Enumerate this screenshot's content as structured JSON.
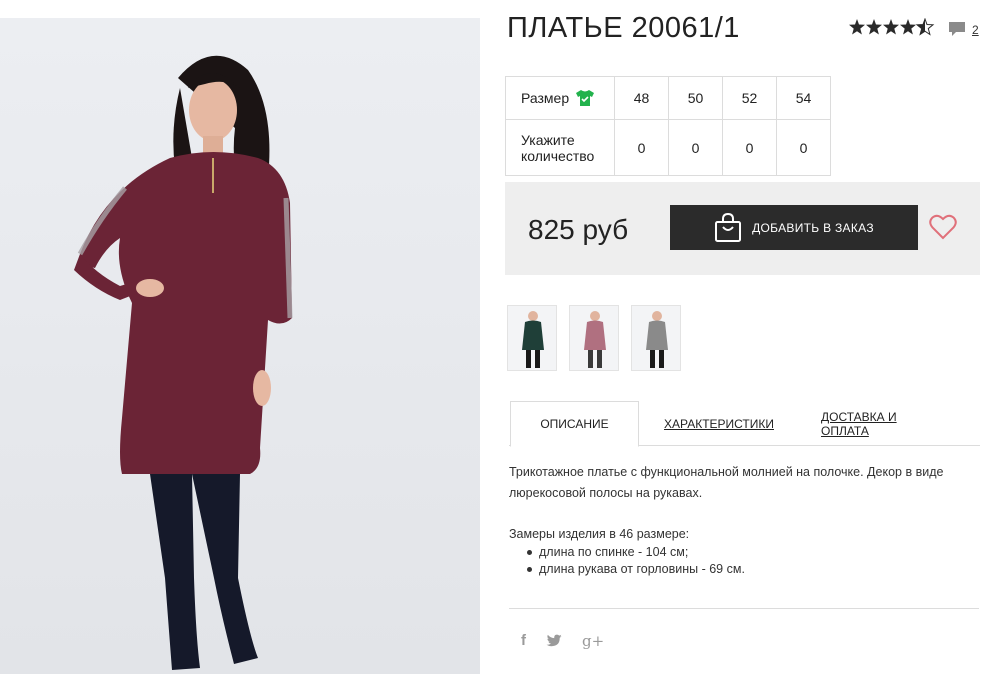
{
  "product": {
    "title": "ПЛАТЬЕ 20061/1",
    "rating_value": 4.5,
    "rating_max": 5,
    "comments_count": "2"
  },
  "sizes": {
    "size_label": "Размер",
    "qty_label_line1": "Укажите",
    "qty_label_line2": "количество",
    "columns": [
      "48",
      "50",
      "52",
      "54"
    ],
    "quantities": [
      "0",
      "0",
      "0",
      "0"
    ]
  },
  "purchase": {
    "price": "825 руб",
    "add_button": "ДОБАВИТЬ В ЗАКАЗ"
  },
  "thumbnails": [
    {
      "color": "#1f3f38"
    },
    {
      "color": "#6b2436"
    },
    {
      "color": "#8a8a8a"
    }
  ],
  "tabs": {
    "description": "ОПИСАНИЕ",
    "characteristics": "ХАРАКТЕРИСТИКИ",
    "delivery": "ДОСТАВКА И ОПЛАТА"
  },
  "description": {
    "text": "Трикотажное платье с функциональной молнией на полочке. Декор в виде люрекосовой полосы на рукавах.",
    "measures_title": "Замеры изделия в 46 размере:",
    "measures": [
      "длина по спинке - 104 см;",
      "длина рукава от горловины - 69 см."
    ]
  },
  "social": {
    "facebook": "f",
    "google": "g+"
  },
  "colors": {
    "dress": "#6b2436",
    "button": "#2b2b2b",
    "heart": "#e0707a",
    "size_icon": "#22b24c"
  },
  "icons": [
    "star-icon",
    "comment-icon",
    "tshirt-icon",
    "shopping-bag-icon",
    "heart-icon",
    "facebook-icon",
    "twitter-icon",
    "google-plus-icon"
  ]
}
